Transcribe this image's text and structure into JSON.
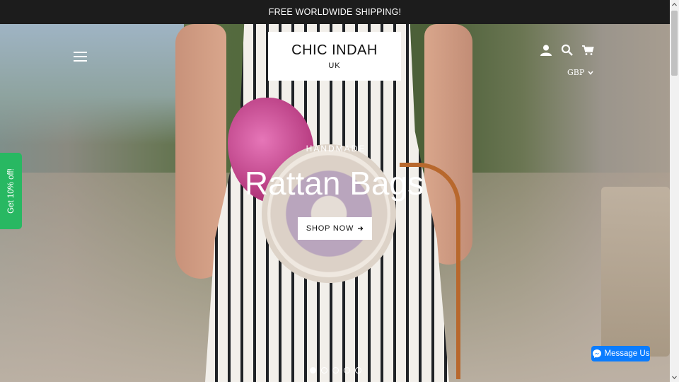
{
  "announcement": {
    "text": "FREE WORLDWIDE SHIPPING!"
  },
  "header": {
    "logo_line1": "CHIC INDAH",
    "logo_line2": "UK",
    "currency": "GBP",
    "icons": [
      "menu-icon",
      "account-icon",
      "search-icon",
      "cart-icon",
      "chevron-down-icon"
    ]
  },
  "hero": {
    "eyebrow": "HANDMADE",
    "headline": "Rattan Bags",
    "cta_label": "SHOP NOW",
    "cta_icon": "arrow-right-icon",
    "slide_count": 5,
    "active_slide": 1
  },
  "promo_tab": {
    "label": "Get 10% off!",
    "color": "#28b862"
  },
  "messenger": {
    "label": "Message Us",
    "color": "#0a7cff"
  },
  "colors": {
    "announcement_bg": "#1c1c1c"
  }
}
